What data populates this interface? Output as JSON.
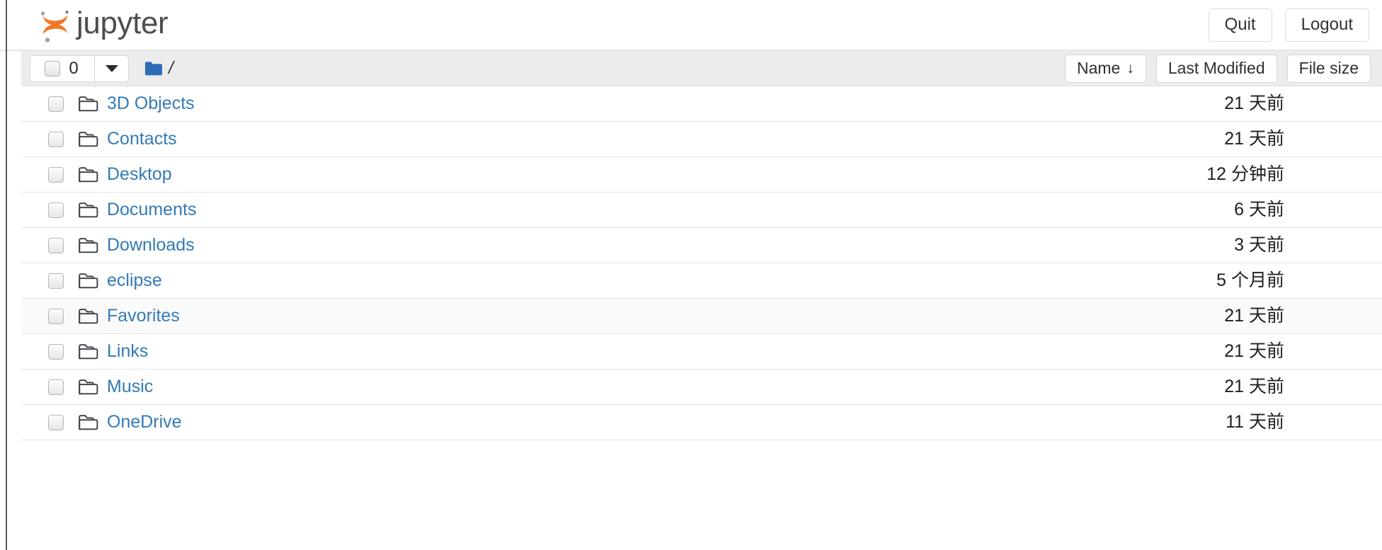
{
  "header": {
    "brand_word": "jupyter",
    "logo_icon": "jupyter-logo",
    "quit_label": "Quit",
    "logout_label": "Logout"
  },
  "toolbar": {
    "select_count": "0",
    "select_checkbox_icon": "tri-state-checkbox",
    "dropdown_icon": "chevron-down-icon",
    "breadcrumb_root_icon": "folder-filled-icon",
    "breadcrumb_separator": "/",
    "sort_buttons": [
      {
        "label": "Name",
        "arrow": "↓",
        "sorted": true,
        "name": "sort-name-button"
      },
      {
        "label": "Last Modified",
        "arrow": "",
        "sorted": false,
        "name": "sort-last-modified-button"
      },
      {
        "label": "File size",
        "arrow": "",
        "sorted": false,
        "name": "sort-file-size-button"
      }
    ]
  },
  "colors": {
    "link": "#337ab7",
    "brand_orange": "#f37726",
    "brand_gray": "#9e9e9e",
    "toolbar_bg": "#ececec",
    "folder_blue": "#2b6cb8",
    "row_highlight": "#fafafa"
  },
  "file_list": {
    "items": [
      {
        "name": "3D Objects",
        "type": "directory",
        "icon": "folder-icon",
        "modified": "21 天前",
        "size": "",
        "highlighted": false
      },
      {
        "name": "Contacts",
        "type": "directory",
        "icon": "folder-icon",
        "modified": "21 天前",
        "size": "",
        "highlighted": false
      },
      {
        "name": "Desktop",
        "type": "directory",
        "icon": "folder-icon",
        "modified": "12 分钟前",
        "size": "",
        "highlighted": false
      },
      {
        "name": "Documents",
        "type": "directory",
        "icon": "folder-icon",
        "modified": "6 天前",
        "size": "",
        "highlighted": false
      },
      {
        "name": "Downloads",
        "type": "directory",
        "icon": "folder-icon",
        "modified": "3 天前",
        "size": "",
        "highlighted": false
      },
      {
        "name": "eclipse",
        "type": "directory",
        "icon": "folder-icon",
        "modified": "5 个月前",
        "size": "",
        "highlighted": false
      },
      {
        "name": "Favorites",
        "type": "directory",
        "icon": "folder-icon",
        "modified": "21 天前",
        "size": "",
        "highlighted": true
      },
      {
        "name": "Links",
        "type": "directory",
        "icon": "folder-icon",
        "modified": "21 天前",
        "size": "",
        "highlighted": false
      },
      {
        "name": "Music",
        "type": "directory",
        "icon": "folder-icon",
        "modified": "21 天前",
        "size": "",
        "highlighted": false
      },
      {
        "name": "OneDrive",
        "type": "directory",
        "icon": "folder-icon",
        "modified": "11 天前",
        "size": "",
        "highlighted": false
      }
    ]
  }
}
